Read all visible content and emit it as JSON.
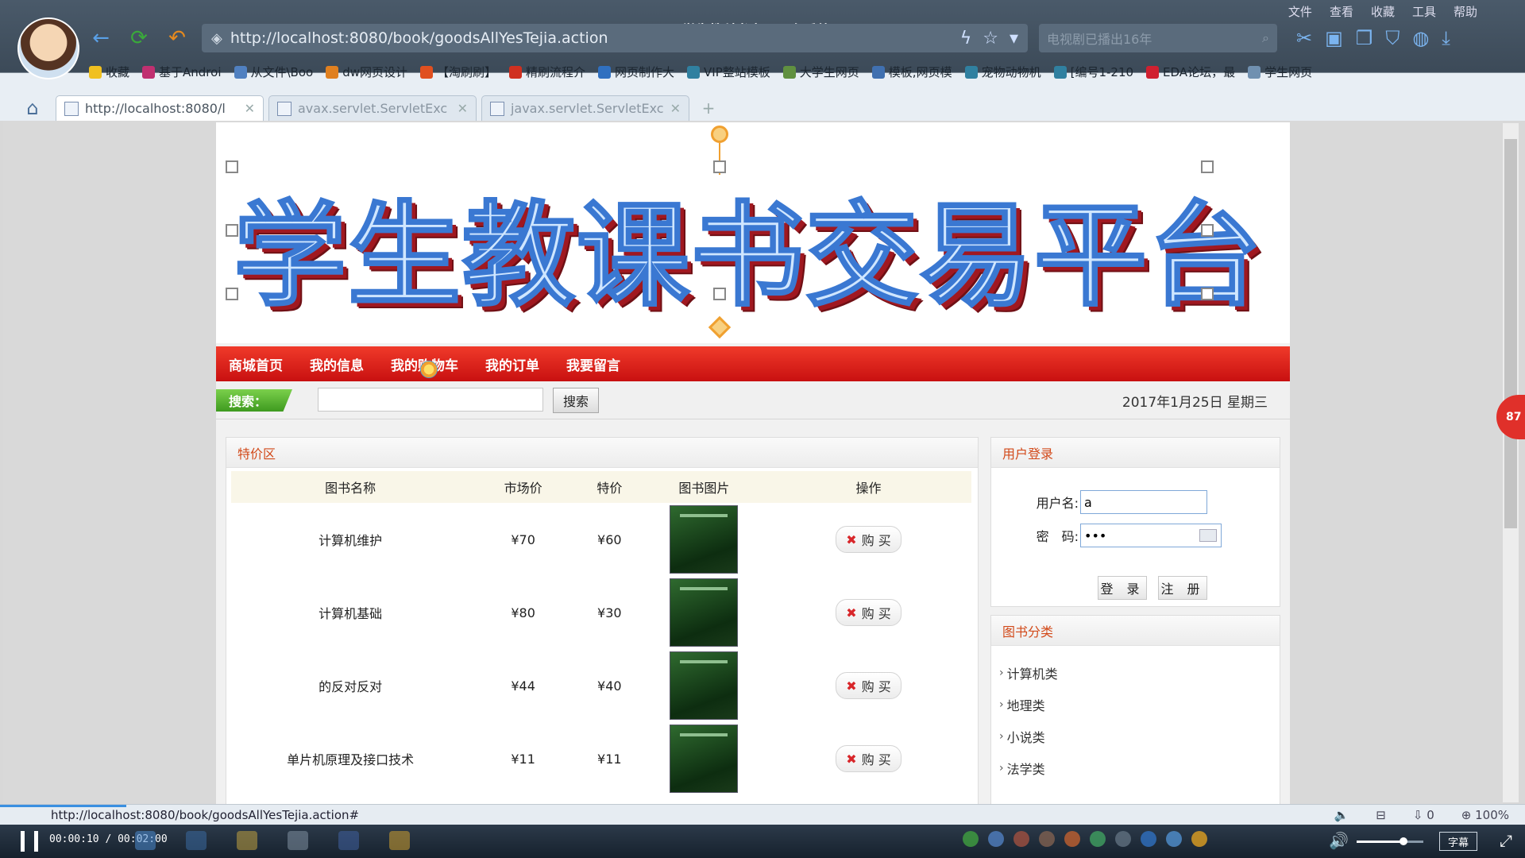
{
  "player": {
    "video_title": "022学生教科书交易平台系统.wmv",
    "time": "00:00:10 / 00:02:00",
    "progress": 0.083,
    "volume": 0.7,
    "subtitle_label": "字幕"
  },
  "browser": {
    "top_menu": [
      "文件",
      "查看",
      "收藏",
      "工具",
      "帮助"
    ],
    "url": "http://localhost:8080/book/goodsAllYesTejia.action",
    "search_placeholder": "电视剧已播出16年",
    "bookmarks": [
      {
        "label": "收藏",
        "color": "#f0c020"
      },
      {
        "label": "基于Androi",
        "color": "#c03070"
      },
      {
        "label": "从文件\\Boo",
        "color": "#5080c0"
      },
      {
        "label": "dw网页设计",
        "color": "#e08020"
      },
      {
        "label": "【淘刷刷】",
        "color": "#e05020"
      },
      {
        "label": "精刷流程介",
        "color": "#d03020"
      },
      {
        "label": "网页制作大",
        "color": "#3070c0"
      },
      {
        "label": "VIP整站模板",
        "color": "#3080a0"
      },
      {
        "label": "大学生网页",
        "color": "#609040"
      },
      {
        "label": "模板,网页模",
        "color": "#4070b0"
      },
      {
        "label": "宠物动物机",
        "color": "#3080a0"
      },
      {
        "label": "[编号1-210",
        "color": "#3080a0"
      },
      {
        "label": "EDA论坛，最",
        "color": "#d02030"
      },
      {
        "label": "学生网页",
        "color": "#7090b0"
      }
    ],
    "tabs": [
      {
        "label": "http://localhost:8080/l",
        "active": true
      },
      {
        "label": "avax.servlet.ServletExc",
        "active": false
      },
      {
        "label": "javax.servlet.ServletExc",
        "active": false
      }
    ],
    "status_url": "http://localhost:8080/book/goodsAllYesTejia.action#",
    "status_right": [
      "0",
      "100%"
    ],
    "side_badge": "87"
  },
  "site": {
    "banner_title": "学生教课书交易平台",
    "menu": [
      "商城首页",
      "我的信息",
      "我的购物车",
      "我的订单",
      "我要留言"
    ],
    "search_label": "搜索：",
    "search_value": "",
    "search_button": "搜索",
    "date": "2017年1月25日 星期三",
    "special": {
      "title": "特价区",
      "columns": [
        "图书名称",
        "市场价",
        "特价",
        "图书图片",
        "操作"
      ],
      "rows": [
        {
          "name": "计算机维护",
          "market": "¥70",
          "special": "¥60"
        },
        {
          "name": "计算机基础",
          "market": "¥80",
          "special": "¥30"
        },
        {
          "name": "的反对反对",
          "market": "¥44",
          "special": "¥40"
        },
        {
          "name": "单片机原理及接口技术",
          "market": "¥11",
          "special": "¥11"
        }
      ],
      "buy_label": "购 买"
    },
    "login": {
      "title": "用户登录",
      "username_label": "用户名:",
      "username_value": "a",
      "password_label": "密　码:",
      "password_value": "•••",
      "login_button": "登 录",
      "register_button": "注 册"
    },
    "categories": {
      "title": "图书分类",
      "items": [
        "计算机类",
        "地理类",
        "小说类",
        "法学类"
      ]
    }
  }
}
